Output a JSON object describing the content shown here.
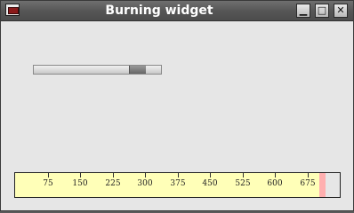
{
  "window": {
    "title": "Burning widget",
    "buttons": {
      "minimize_icon": "minimize-icon",
      "maximize_icon": "maximize-icon",
      "close_icon": "close-icon"
    }
  },
  "slider": {
    "value_fraction": 0.86
  },
  "burning": {
    "max": 750,
    "value": 700,
    "ticks": [
      "75",
      "150",
      "225",
      "300",
      "375",
      "450",
      "525",
      "600",
      "675"
    ],
    "colors": {
      "background": "#ffffb8",
      "burn": "#ffafaf",
      "empty": "#e6e6e6"
    }
  }
}
